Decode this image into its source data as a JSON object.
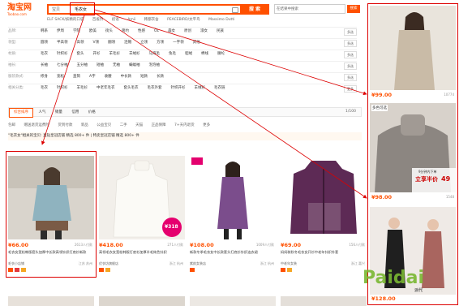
{
  "header": {
    "logo_cn": "淘宝网",
    "logo_en": "Taobao.com",
    "search_scope": "宝贝",
    "search_query": "毛衣女",
    "search_button": "搜 索",
    "shop_search_placeholder": "在结果中搜索",
    "shop_search_button": "搜索",
    "hot_words": [
      "ELF SACK/妖精的口袋",
      "百雀羚",
      "初语",
      "Amii",
      "韩都衣舍",
      "PEACEBIRD/太平鸟",
      "Massimo Dutti"
    ]
  },
  "facets": [
    {
      "label": "品牌:",
      "values": [
        "韩系",
        "伊周",
        "学院",
        "欧美",
        "街头",
        "简约",
        "性感",
        "OL",
        "森女",
        "原创",
        "淑女",
        "民族"
      ],
      "more": "多选"
    },
    {
      "label": "领型:",
      "values": [
        "圆领",
        "半高领",
        "高领",
        "V领",
        "翻领",
        "连帽",
        "立领",
        "方领",
        "一字领",
        "其他"
      ],
      "more": "多选"
    },
    {
      "label": "材质:",
      "values": [
        "毛衣",
        "针织衫",
        "套头",
        "开衫",
        "羊毛衫",
        "羊绒衫",
        "马海毛",
        "兔毛",
        "貂绒",
        "棉线",
        "腈纶"
      ],
      "more": "多选"
    },
    {
      "label": "袖长:",
      "values": [
        "长袖",
        "七分袖",
        "五分袖",
        "短袖",
        "无袖",
        "蝙蝠袖",
        "泡泡袖"
      ],
      "more": "多选"
    },
    {
      "label": "服装款式:",
      "values": [
        "修身",
        "宽松",
        "直筒",
        "A字",
        "收腰",
        "中长款",
        "短款",
        "长款"
      ],
      "more": "多选"
    },
    {
      "label": "相关分类:",
      "values": [
        "毛衣",
        "针织衫",
        "羊毛衫",
        "中老年毛衣",
        "套头毛衣",
        "毛衣外套",
        "针织开衫",
        "羊绒衫",
        "毛衣链"
      ],
      "more": "更多"
    }
  ],
  "sortbar": {
    "tabs": [
      "综合排序",
      "人气",
      "销量",
      "信用",
      "价格"
    ],
    "active": "综合排序",
    "page_info": "1/100"
  },
  "filters": [
    "包邮",
    "赠送退货运费险",
    "货到付款",
    "新品",
    "公益宝贝",
    "二手",
    "天猫",
    "正品保障",
    "7+天内退货",
    "更多"
  ],
  "notice": "\"毛衣女\"相关的宝贝: 直钻皇冠店铺 精选 800+ 件 | 特卖皇冠店铺 精选 800+ 件",
  "products": [
    {
      "price": "¥66.00",
      "buyers": "2613人付款",
      "title": "毛衣女宽松韩版套头加厚中长款高领针织打底衫新款",
      "shop": "毛衣小店铺",
      "location": "江苏 苏州"
    },
    {
      "price": "¥418.00",
      "buyers": "271人付款",
      "title": "高领毛衣女宽松韩版打底衫加厚羊毛纯色针织",
      "shop": "优衣坊旗舰店",
      "location": "浙江 杭州"
    },
    {
      "price": "¥108.00",
      "buyers": "1009人付款",
      "title": "新款冬季毛衣女中长款套头打底衫针织连衣裙",
      "shop": "紫韵女装店",
      "location": "浙江 杭州"
    },
    {
      "price": "¥69.00",
      "buyers": "156人付款",
      "title": "妈妈装秋冬毛衣女开衫中老年针织外套",
      "shop": "中老年女装",
      "location": "浙江 嘉兴"
    }
  ],
  "rightcol": [
    {
      "price": "¥99.00",
      "buyers": "10774"
    },
    {
      "price": "¥98.00",
      "buyers": "1548",
      "promo_top": "多色可选",
      "promo_line1": "9分钟内下单",
      "promo_line2": "立享半价",
      "promo_price": "49"
    },
    {
      "price": "¥128.00",
      "buyers": ""
    }
  ],
  "card_promo": "¥318",
  "watermark": {
    "brand": "Paidai",
    "sub": "派代"
  },
  "colors": {
    "accent": "#ff5000",
    "highlight": "#dd0000"
  }
}
